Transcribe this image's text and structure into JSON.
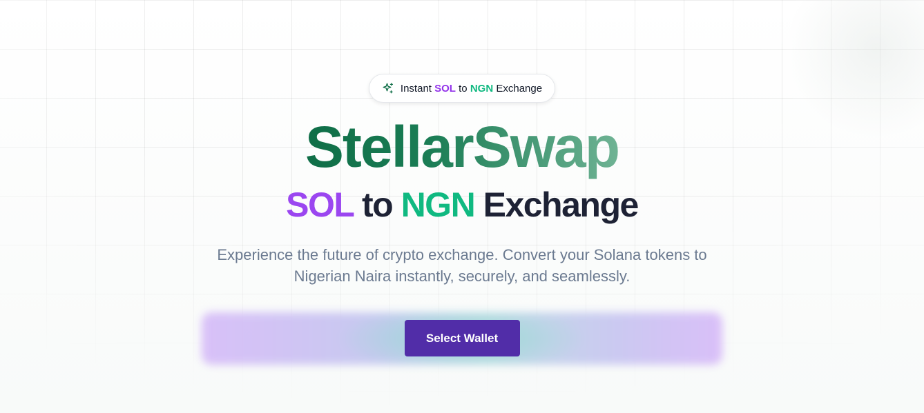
{
  "badge": {
    "icon": "sparkles-icon",
    "prefix": "Instant",
    "sol": "SOL",
    "to": "to",
    "ngn": "NGN",
    "suffix": "Exchange"
  },
  "hero": {
    "title": "StellarSwap",
    "subtitle_sol": "SOL",
    "subtitle_to": "to",
    "subtitle_ngn": "NGN",
    "subtitle_exchange": "Exchange",
    "description": "Experience the future of crypto exchange. Convert your Solana tokens to Nigerian Naira instantly, securely, and seamlessly."
  },
  "cta": {
    "label": "Select Wallet"
  },
  "colors": {
    "brand_green": "#0f6e47",
    "sol_purple": "#9b46f0",
    "ngn_green": "#10b981",
    "button": "#512da8",
    "text_dark": "#1e2235",
    "text_muted": "#6b7a90"
  }
}
